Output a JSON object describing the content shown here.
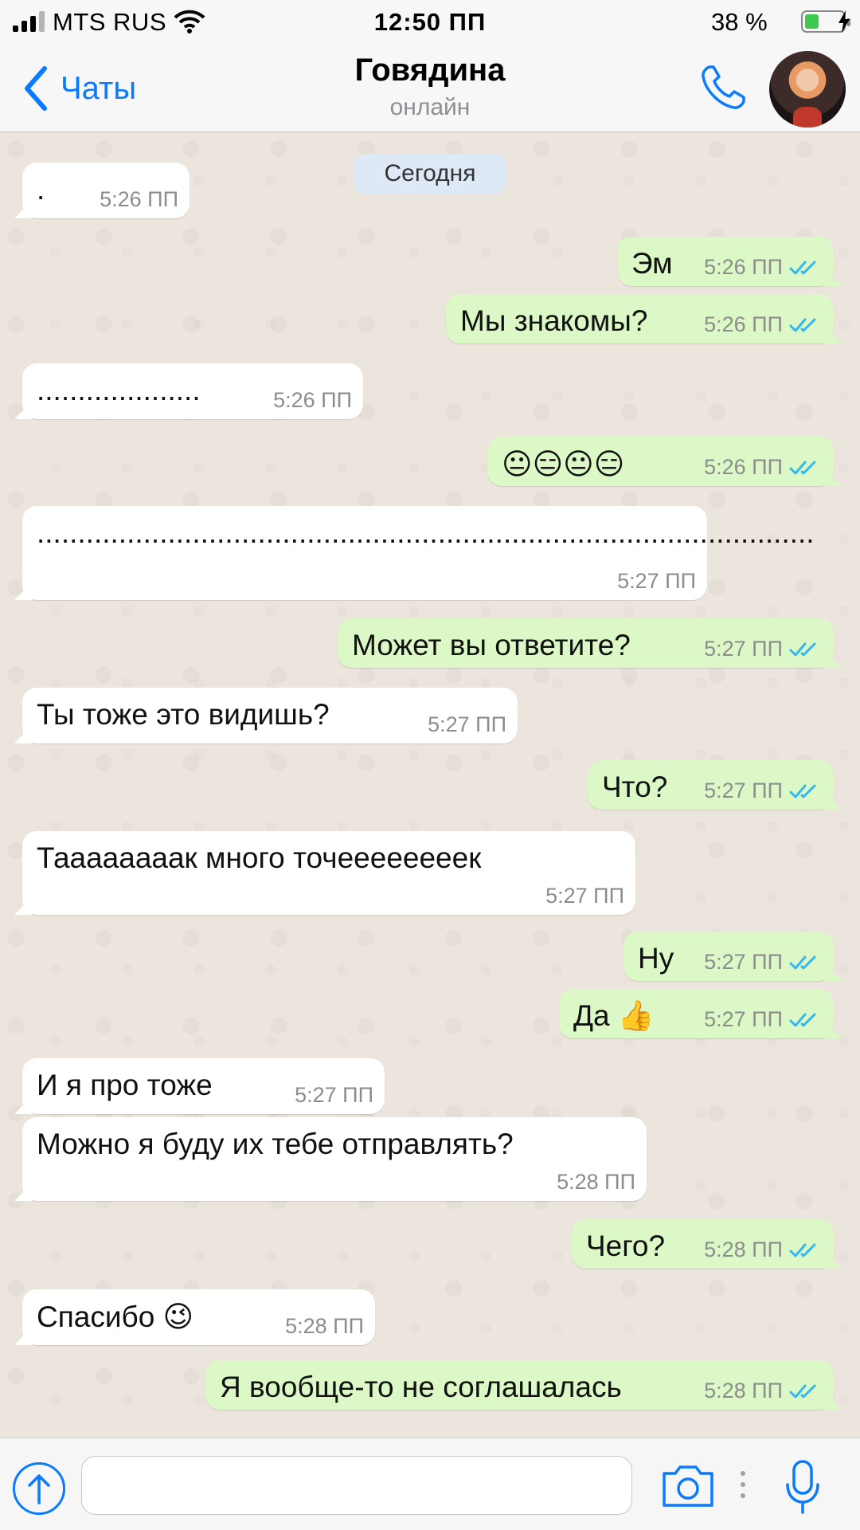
{
  "status_bar": {
    "carrier": "MTS RUS",
    "time": "12:50 ПП",
    "battery_percent": "38 %",
    "battery_level": 0.38,
    "signal_bars_filled": 3,
    "signal_bars_total": 4,
    "icons": [
      "cellular-signal-icon",
      "wifi-icon",
      "battery-icon",
      "charging-bolt-icon"
    ]
  },
  "header": {
    "back_label": "Чаты",
    "contact_name": "Говядина",
    "contact_status": "онлайн",
    "icons": [
      "chevron-left-icon",
      "phone-icon",
      "avatar"
    ]
  },
  "chat": {
    "date_separator": "Сегодня",
    "messages": [
      {
        "direction": "in",
        "text": ".",
        "time": "5:26 ПП"
      },
      {
        "direction": "out",
        "text": "Эм",
        "time": "5:26 ПП",
        "status": "read"
      },
      {
        "direction": "out",
        "text": "Мы знакомы?",
        "time": "5:26 ПП",
        "status": "read"
      },
      {
        "direction": "in",
        "text": "....................",
        "time": "5:26 ПП"
      },
      {
        "direction": "out",
        "text": "😐😑😐😑",
        "time": "5:26 ПП",
        "status": "read"
      },
      {
        "direction": "in",
        "text": "...............................................................................................",
        "time": "5:27 ПП"
      },
      {
        "direction": "out",
        "text": "Может вы ответите?",
        "time": "5:27 ПП",
        "status": "read"
      },
      {
        "direction": "in",
        "text": "Ты тоже это видишь?",
        "time": "5:27 ПП"
      },
      {
        "direction": "out",
        "text": "Что?",
        "time": "5:27 ПП",
        "status": "read"
      },
      {
        "direction": "in",
        "text": "Таааааааак много точеееееееек",
        "time": "5:27 ПП"
      },
      {
        "direction": "out",
        "text": "Ну",
        "time": "5:27 ПП",
        "status": "read"
      },
      {
        "direction": "out",
        "text": "Да 👍",
        "time": "5:27 ПП",
        "status": "read"
      },
      {
        "direction": "in",
        "text": "И я про тоже",
        "time": "5:27 ПП"
      },
      {
        "direction": "in",
        "text": "Можно я буду их тебе отправлять?",
        "time": "5:28 ПП"
      },
      {
        "direction": "out",
        "text": "Чего?",
        "time": "5:28 ПП",
        "status": "read"
      },
      {
        "direction": "in",
        "text": "Спасибо 😉",
        "time": "5:28 ПП"
      },
      {
        "direction": "out",
        "text": "Я вообще-то не соглашалась",
        "time": "5:28 ПП",
        "status": "read"
      }
    ],
    "colors": {
      "background": "#ece5dd",
      "incoming_bubble": "#ffffff",
      "outgoing_bubble": "#dcf8c6",
      "read_ticks": "#34b7f1",
      "accent": "#0a7aff"
    }
  },
  "input_bar": {
    "message_value": "",
    "icons": [
      "upload-arrow-icon",
      "camera-icon",
      "more-dots-icon",
      "microphone-icon"
    ]
  }
}
